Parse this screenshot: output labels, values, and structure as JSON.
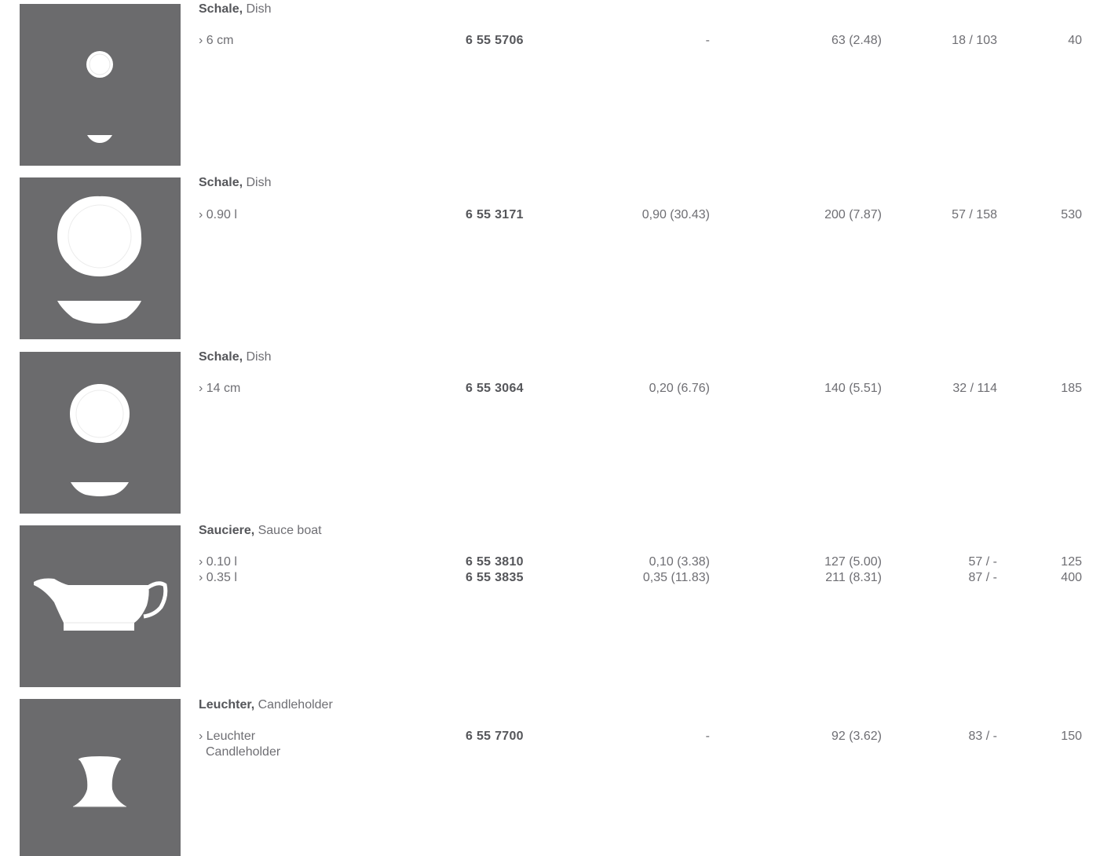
{
  "products": [
    {
      "name_de": "Schale,",
      "name_en": "Dish",
      "rows": [
        {
          "desc": "› 6 cm",
          "desc2": "",
          "article": "6 55 5706",
          "volume": "-",
          "size": "63 (2.48)",
          "pack": "18 / 103",
          "weight": "40"
        }
      ]
    },
    {
      "name_de": "Schale,",
      "name_en": "Dish",
      "rows": [
        {
          "desc": "› 0.90 l",
          "desc2": "",
          "article": "6 55 3171",
          "volume": "0,90 (30.43)",
          "size": "200 (7.87)",
          "pack": "57 / 158",
          "weight": "530"
        }
      ]
    },
    {
      "name_de": "Schale,",
      "name_en": "Dish",
      "rows": [
        {
          "desc": "› 14 cm",
          "desc2": "",
          "article": "6 55 3064",
          "volume": "0,20 (6.76)",
          "size": "140 (5.51)",
          "pack": "32 / 114",
          "weight": "185"
        }
      ]
    },
    {
      "name_de": "Sauciere,",
      "name_en": "Sauce boat",
      "rows": [
        {
          "desc": "› 0.10 l",
          "desc2": "",
          "article": "6 55 3810",
          "volume": "0,10 (3.38)",
          "size": "127 (5.00)",
          "pack": "57 / -",
          "weight": "125"
        },
        {
          "desc": "› 0.35 l",
          "desc2": "",
          "article": "6 55 3835",
          "volume": "0,35 (11.83)",
          "size": "211 (8.31)",
          "pack": "87 / -",
          "weight": "400"
        }
      ]
    },
    {
      "name_de": "Leuchter,",
      "name_en": "Candleholder",
      "rows": [
        {
          "desc": "› Leuchter",
          "desc2": "Candleholder",
          "article": "6 55 7700",
          "volume": "-",
          "size": "92 (3.62)",
          "pack": "83 / -",
          "weight": "150"
        }
      ]
    }
  ]
}
